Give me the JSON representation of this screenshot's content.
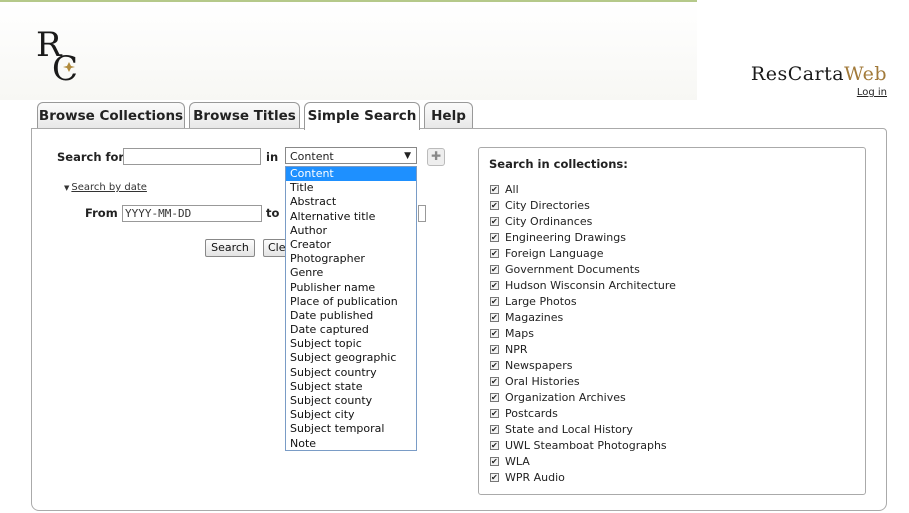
{
  "header": {
    "logo_letters": "RC",
    "brand": {
      "part1": "ResCarta",
      "part2": "Web"
    },
    "login_label": "Log in"
  },
  "tabs": [
    {
      "label": "Browse Collections",
      "active": false
    },
    {
      "label": "Browse Titles",
      "active": false
    },
    {
      "label": "Simple Search",
      "active": true
    },
    {
      "label": "Help",
      "active": false
    }
  ],
  "search": {
    "search_for_label": "Search for",
    "search_for_value": "",
    "in_label": "in",
    "field_selected": "Content",
    "field_options": [
      "Content",
      "Title",
      "Abstract",
      "Alternative title",
      "Author",
      "Creator",
      "Photographer",
      "Genre",
      "Publisher name",
      "Place of publication",
      "Date published",
      "Date captured",
      "Subject topic",
      "Subject geographic",
      "Subject country",
      "Subject state",
      "Subject county",
      "Subject city",
      "Subject temporal",
      "Note"
    ],
    "add_icon": "plus-icon",
    "date_toggle_label": "Search by date",
    "from_label": "From",
    "from_placeholder": "YYYY-MM-DD",
    "to_label": "to",
    "search_button": "Search",
    "clear_button": "Cle"
  },
  "collections": {
    "title": "Search in collections:",
    "items": [
      "All",
      "City Directories",
      "City Ordinances",
      "Engineering Drawings",
      "Foreign Language",
      "Government Documents",
      "Hudson Wisconsin Architecture",
      "Large Photos",
      "Magazines",
      "Maps",
      "NPR",
      "Newspapers",
      "Oral Histories",
      "Organization Archives",
      "Postcards",
      "State and Local History",
      "UWL Steamboat Photographs",
      "WLA",
      "WPR Audio"
    ],
    "all_checked": true
  }
}
